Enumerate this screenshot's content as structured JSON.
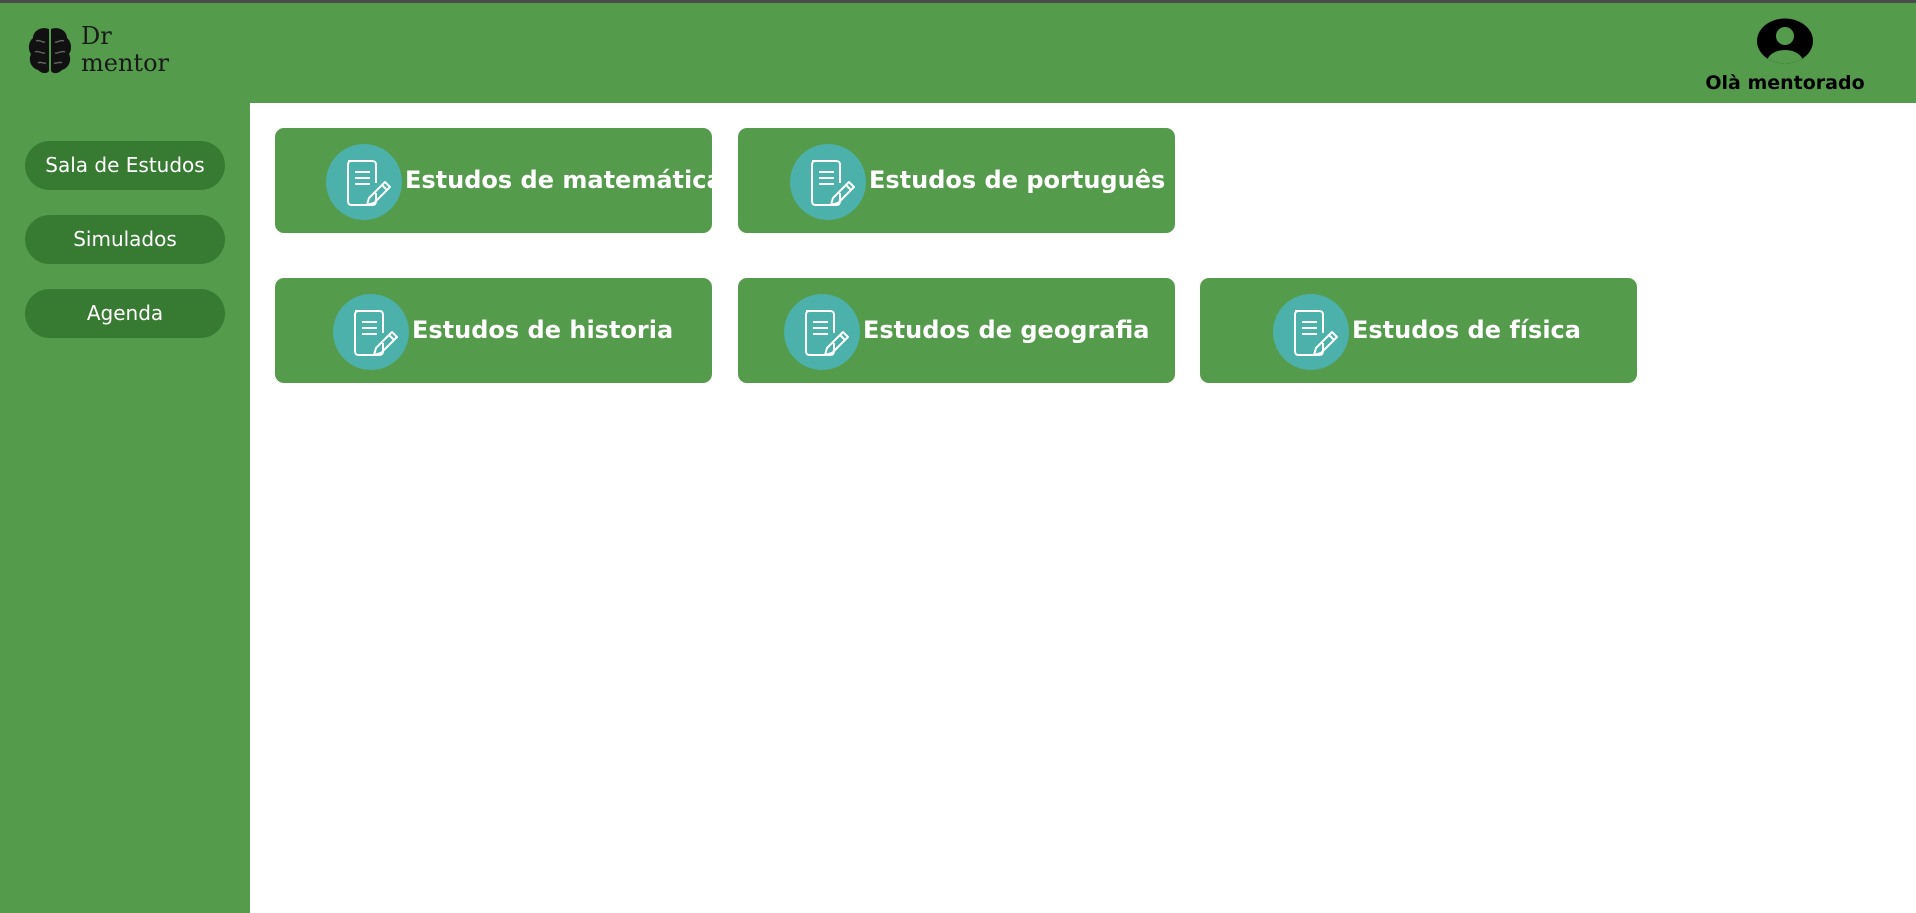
{
  "colors": {
    "brand": "#549b4c",
    "nav_button_bg": "#377a31",
    "icon_circle": "#4bb1aa"
  },
  "header": {
    "logo_icon": "brain-icon",
    "logo_line1": "Dr",
    "logo_line2": "mentor",
    "user_icon": "user-avatar-icon",
    "greeting": "Olà mentorado"
  },
  "sidebar": {
    "items": [
      {
        "label": "Sala de Estudos"
      },
      {
        "label": "Simulados"
      },
      {
        "label": "Agenda"
      }
    ]
  },
  "cards": [
    {
      "label": "Estudos de matemática",
      "icon": "document-pencil-icon"
    },
    {
      "label": "Estudos de português",
      "icon": "document-pencil-icon"
    },
    {
      "label": "Estudos de historia",
      "icon": "document-pencil-icon"
    },
    {
      "label": "Estudos de geografia",
      "icon": "document-pencil-icon"
    },
    {
      "label": "Estudos de física",
      "icon": "document-pencil-icon"
    }
  ]
}
